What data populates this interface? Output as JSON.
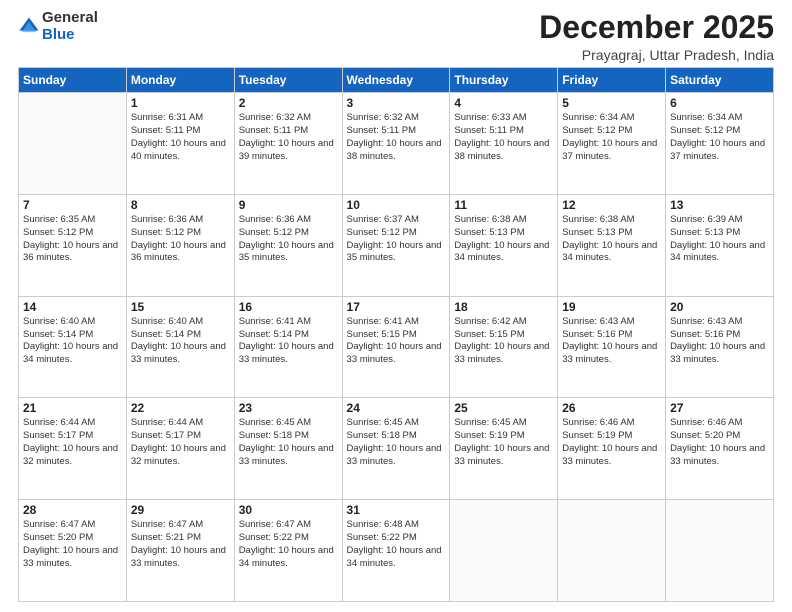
{
  "logo": {
    "general": "General",
    "blue": "Blue"
  },
  "header": {
    "month_year": "December 2025",
    "location": "Prayagraj, Uttar Pradesh, India"
  },
  "weekdays": [
    "Sunday",
    "Monday",
    "Tuesday",
    "Wednesday",
    "Thursday",
    "Friday",
    "Saturday"
  ],
  "weeks": [
    [
      {
        "day": "",
        "info": ""
      },
      {
        "day": "1",
        "info": "Sunrise: 6:31 AM\nSunset: 5:11 PM\nDaylight: 10 hours and 40 minutes."
      },
      {
        "day": "2",
        "info": "Sunrise: 6:32 AM\nSunset: 5:11 PM\nDaylight: 10 hours and 39 minutes."
      },
      {
        "day": "3",
        "info": "Sunrise: 6:32 AM\nSunset: 5:11 PM\nDaylight: 10 hours and 38 minutes."
      },
      {
        "day": "4",
        "info": "Sunrise: 6:33 AM\nSunset: 5:11 PM\nDaylight: 10 hours and 38 minutes."
      },
      {
        "day": "5",
        "info": "Sunrise: 6:34 AM\nSunset: 5:12 PM\nDaylight: 10 hours and 37 minutes."
      },
      {
        "day": "6",
        "info": "Sunrise: 6:34 AM\nSunset: 5:12 PM\nDaylight: 10 hours and 37 minutes."
      }
    ],
    [
      {
        "day": "7",
        "info": "Sunrise: 6:35 AM\nSunset: 5:12 PM\nDaylight: 10 hours and 36 minutes."
      },
      {
        "day": "8",
        "info": "Sunrise: 6:36 AM\nSunset: 5:12 PM\nDaylight: 10 hours and 36 minutes."
      },
      {
        "day": "9",
        "info": "Sunrise: 6:36 AM\nSunset: 5:12 PM\nDaylight: 10 hours and 35 minutes."
      },
      {
        "day": "10",
        "info": "Sunrise: 6:37 AM\nSunset: 5:12 PM\nDaylight: 10 hours and 35 minutes."
      },
      {
        "day": "11",
        "info": "Sunrise: 6:38 AM\nSunset: 5:13 PM\nDaylight: 10 hours and 34 minutes."
      },
      {
        "day": "12",
        "info": "Sunrise: 6:38 AM\nSunset: 5:13 PM\nDaylight: 10 hours and 34 minutes."
      },
      {
        "day": "13",
        "info": "Sunrise: 6:39 AM\nSunset: 5:13 PM\nDaylight: 10 hours and 34 minutes."
      }
    ],
    [
      {
        "day": "14",
        "info": "Sunrise: 6:40 AM\nSunset: 5:14 PM\nDaylight: 10 hours and 34 minutes."
      },
      {
        "day": "15",
        "info": "Sunrise: 6:40 AM\nSunset: 5:14 PM\nDaylight: 10 hours and 33 minutes."
      },
      {
        "day": "16",
        "info": "Sunrise: 6:41 AM\nSunset: 5:14 PM\nDaylight: 10 hours and 33 minutes."
      },
      {
        "day": "17",
        "info": "Sunrise: 6:41 AM\nSunset: 5:15 PM\nDaylight: 10 hours and 33 minutes."
      },
      {
        "day": "18",
        "info": "Sunrise: 6:42 AM\nSunset: 5:15 PM\nDaylight: 10 hours and 33 minutes."
      },
      {
        "day": "19",
        "info": "Sunrise: 6:43 AM\nSunset: 5:16 PM\nDaylight: 10 hours and 33 minutes."
      },
      {
        "day": "20",
        "info": "Sunrise: 6:43 AM\nSunset: 5:16 PM\nDaylight: 10 hours and 33 minutes."
      }
    ],
    [
      {
        "day": "21",
        "info": "Sunrise: 6:44 AM\nSunset: 5:17 PM\nDaylight: 10 hours and 32 minutes."
      },
      {
        "day": "22",
        "info": "Sunrise: 6:44 AM\nSunset: 5:17 PM\nDaylight: 10 hours and 32 minutes."
      },
      {
        "day": "23",
        "info": "Sunrise: 6:45 AM\nSunset: 5:18 PM\nDaylight: 10 hours and 33 minutes."
      },
      {
        "day": "24",
        "info": "Sunrise: 6:45 AM\nSunset: 5:18 PM\nDaylight: 10 hours and 33 minutes."
      },
      {
        "day": "25",
        "info": "Sunrise: 6:45 AM\nSunset: 5:19 PM\nDaylight: 10 hours and 33 minutes."
      },
      {
        "day": "26",
        "info": "Sunrise: 6:46 AM\nSunset: 5:19 PM\nDaylight: 10 hours and 33 minutes."
      },
      {
        "day": "27",
        "info": "Sunrise: 6:46 AM\nSunset: 5:20 PM\nDaylight: 10 hours and 33 minutes."
      }
    ],
    [
      {
        "day": "28",
        "info": "Sunrise: 6:47 AM\nSunset: 5:20 PM\nDaylight: 10 hours and 33 minutes."
      },
      {
        "day": "29",
        "info": "Sunrise: 6:47 AM\nSunset: 5:21 PM\nDaylight: 10 hours and 33 minutes."
      },
      {
        "day": "30",
        "info": "Sunrise: 6:47 AM\nSunset: 5:22 PM\nDaylight: 10 hours and 34 minutes."
      },
      {
        "day": "31",
        "info": "Sunrise: 6:48 AM\nSunset: 5:22 PM\nDaylight: 10 hours and 34 minutes."
      },
      {
        "day": "",
        "info": ""
      },
      {
        "day": "",
        "info": ""
      },
      {
        "day": "",
        "info": ""
      }
    ]
  ]
}
